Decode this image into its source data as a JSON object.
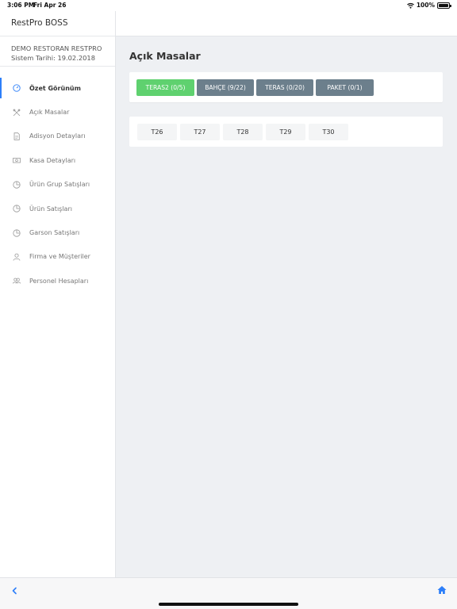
{
  "status": {
    "time": "3:06 PM",
    "date": "Fri Apr 26",
    "battery": "100%"
  },
  "app": {
    "title": "RestPro BOSS"
  },
  "company": {
    "name": "DEMO RESTORAN RESTPRO",
    "system_date": "Sistem Tarihi: 19.02.2018"
  },
  "sidebar": {
    "items": [
      {
        "label": "Özet Görünüm",
        "icon": "gauge-icon",
        "active": true
      },
      {
        "label": "Açık Masalar",
        "icon": "utensils-icon",
        "active": false
      },
      {
        "label": "Adisyon Detayları",
        "icon": "document-icon",
        "active": false
      },
      {
        "label": "Kasa Detayları",
        "icon": "cash-icon",
        "active": false
      },
      {
        "label": "Ürün Grup Satışları",
        "icon": "pie-chart-icon",
        "active": false
      },
      {
        "label": "Ürün Satışları",
        "icon": "pie-chart-icon",
        "active": false
      },
      {
        "label": "Garson Satışları",
        "icon": "pie-chart-icon",
        "active": false
      },
      {
        "label": "Firma ve Müşteriler",
        "icon": "user-icon",
        "active": false
      },
      {
        "label": "Personel Hesapları",
        "icon": "users-icon",
        "active": false
      }
    ]
  },
  "main": {
    "title": "Açık Masalar",
    "tabs": [
      {
        "label": "TERAS2 (0/5)",
        "active": true
      },
      {
        "label": "BAHÇE (9/22)",
        "active": false
      },
      {
        "label": "TERAS (0/20)",
        "active": false
      },
      {
        "label": "PAKET (0/1)",
        "active": false
      }
    ],
    "tables": [
      "T26",
      "T27",
      "T28",
      "T29",
      "T30"
    ]
  },
  "colors": {
    "accent": "#2d7ff9",
    "tab_active": "#5fd16f",
    "tab_inactive": "#6c7f8c",
    "main_bg": "#eef0f3"
  }
}
